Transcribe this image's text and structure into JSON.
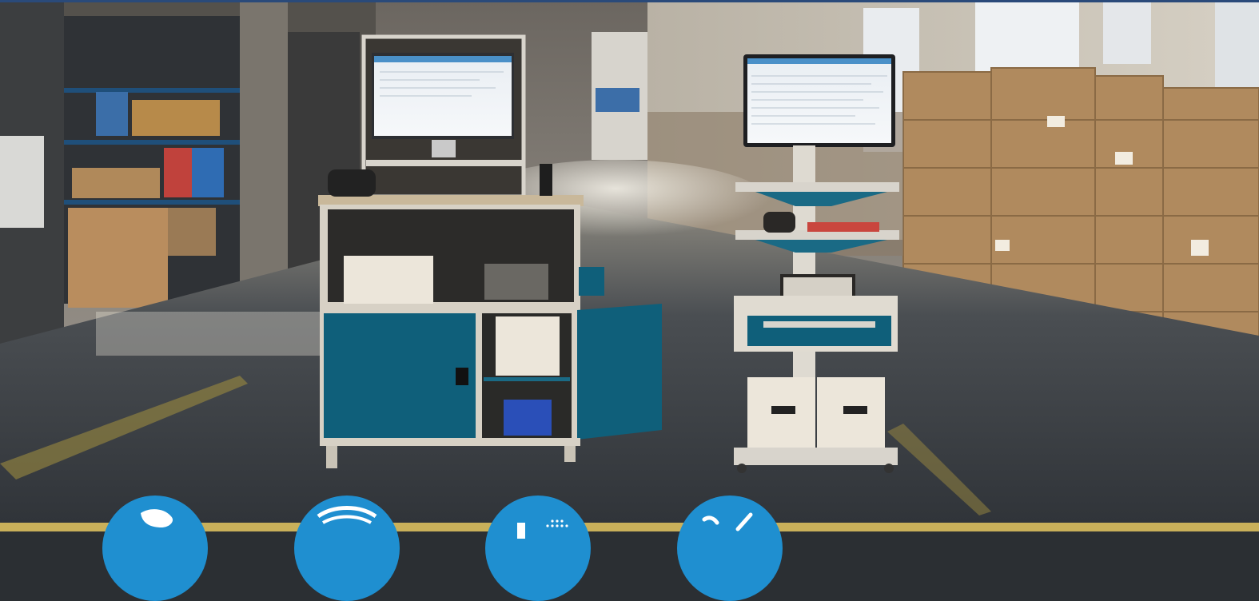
{
  "scene": {
    "description_free": true,
    "colors": {
      "top_accent": "#2a4a7a",
      "bottom_strip": "#c9b05a",
      "badge": "#1f8fd0",
      "cabinet_blue": "#0f5f7a",
      "floor": "#3a3f45"
    }
  },
  "badges": [
    {
      "icon": "map-icon"
    },
    {
      "icon": "shield-icon"
    },
    {
      "icon": "chart-icon"
    },
    {
      "icon": "tools-icon"
    }
  ]
}
